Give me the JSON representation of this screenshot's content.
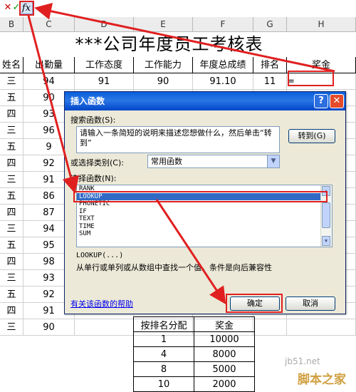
{
  "formula_bar": {
    "cancel_glyph": "✕",
    "enter_glyph": "✓",
    "fx_label": "fx",
    "content": "="
  },
  "columns": [
    "B",
    "C",
    "D",
    "E",
    "F",
    "G",
    "H"
  ],
  "title": "***公司年度员工考核表",
  "headers": [
    "姓名",
    "出勤量",
    "工作态度",
    "工作能力",
    "年度总成绩",
    "排名",
    "奖金"
  ],
  "rows": [
    {
      "name": "三",
      "c": "94",
      "d": "91",
      "e": "90",
      "f": "91.10",
      "g": "11",
      "h": "="
    },
    {
      "name": "五",
      "c": "90",
      "d": "",
      "e": "",
      "f": "",
      "g": "",
      "h": ""
    },
    {
      "name": "四",
      "c": "93",
      "d": "",
      "e": "",
      "f": "",
      "g": "",
      "h": ""
    },
    {
      "name": "三",
      "c": "96",
      "d": "",
      "e": "",
      "f": "",
      "g": "",
      "h": ""
    },
    {
      "name": "五",
      "c": "9",
      "d": "",
      "e": "",
      "f": "",
      "g": "",
      "h": ""
    },
    {
      "name": "四",
      "c": "92",
      "d": "",
      "e": "",
      "f": "",
      "g": "",
      "h": ""
    },
    {
      "name": "三",
      "c": "91",
      "d": "",
      "e": "",
      "f": "",
      "g": "",
      "h": ""
    },
    {
      "name": "五",
      "c": "86",
      "d": "",
      "e": "",
      "f": "",
      "g": "",
      "h": ""
    },
    {
      "name": "四",
      "c": "87",
      "d": "",
      "e": "",
      "f": "",
      "g": "",
      "h": ""
    },
    {
      "name": "三",
      "c": "94",
      "d": "",
      "e": "",
      "f": "",
      "g": "",
      "h": ""
    },
    {
      "name": "五",
      "c": "95",
      "d": "",
      "e": "",
      "f": "",
      "g": "",
      "h": ""
    },
    {
      "name": "四",
      "c": "98",
      "d": "",
      "e": "",
      "f": "",
      "g": "",
      "h": ""
    },
    {
      "name": "三",
      "c": "93",
      "d": "",
      "e": "",
      "f": "",
      "g": "",
      "h": ""
    },
    {
      "name": "五",
      "c": "92",
      "d": "",
      "e": "",
      "f": "",
      "g": "",
      "h": ""
    },
    {
      "name": "四",
      "c": "91",
      "d": "",
      "e": "",
      "f": "",
      "g": "",
      "h": ""
    },
    {
      "name": "三",
      "c": "90",
      "d": "",
      "e": "",
      "f": "",
      "g": "",
      "h": ""
    }
  ],
  "dialog": {
    "title": "插入函数",
    "help_glyph": "?",
    "close_glyph": "✕",
    "search_label": "搜索函数(S):",
    "search_text": "请输入一条简短的说明来描述您想做什么，然后单击“转到”",
    "go_button": "转到(G)",
    "category_label": "或选择类别(C):",
    "category_value": "常用函数",
    "function_label": "选择函数(N):",
    "functions": [
      "RANK",
      "LOOKUP",
      "PHONETIC",
      "IF",
      "TEXT",
      "TIME",
      "SUM"
    ],
    "selected_function": "LOOKUP",
    "signature": "LOOKUP(...)",
    "description": "从单行或单列或从数组中查找一个值。条件是向后兼容性",
    "help_link": "有关该函数的帮助",
    "ok_button": "确定",
    "cancel_button": "取消"
  },
  "bonus_table": {
    "headers": [
      "按排名分配",
      "奖金"
    ],
    "rows": [
      [
        "1",
        "10000"
      ],
      [
        "4",
        "8000"
      ],
      [
        "8",
        "5000"
      ],
      [
        "10",
        "2000"
      ]
    ]
  },
  "watermark": {
    "line1": "jb51.net",
    "line2": "脚本之家"
  },
  "colors": {
    "highlight": "#e02020",
    "selection": "#316ac5",
    "titlebar": "#0a5fd8"
  }
}
